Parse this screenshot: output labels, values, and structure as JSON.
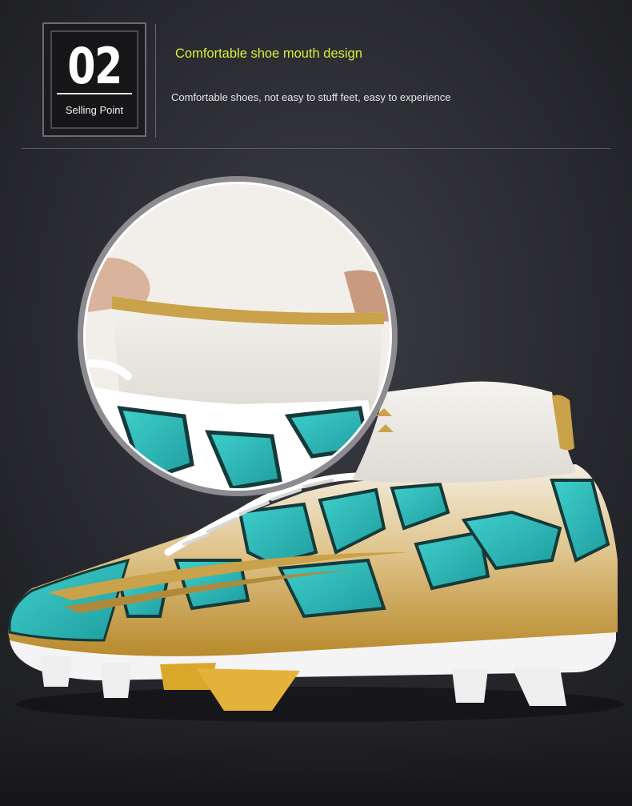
{
  "badge": {
    "number": "02",
    "label": "Selling Point"
  },
  "feature": {
    "headline": "Comfortable shoe mouth design",
    "description": "Comfortable shoes, not easy to stuff feet, easy to experience"
  },
  "colors": {
    "background": "#2b2c31",
    "headline": "#d9ec3a",
    "accent_teal": "#2fc1bf",
    "accent_gold": "#c9a24a"
  }
}
